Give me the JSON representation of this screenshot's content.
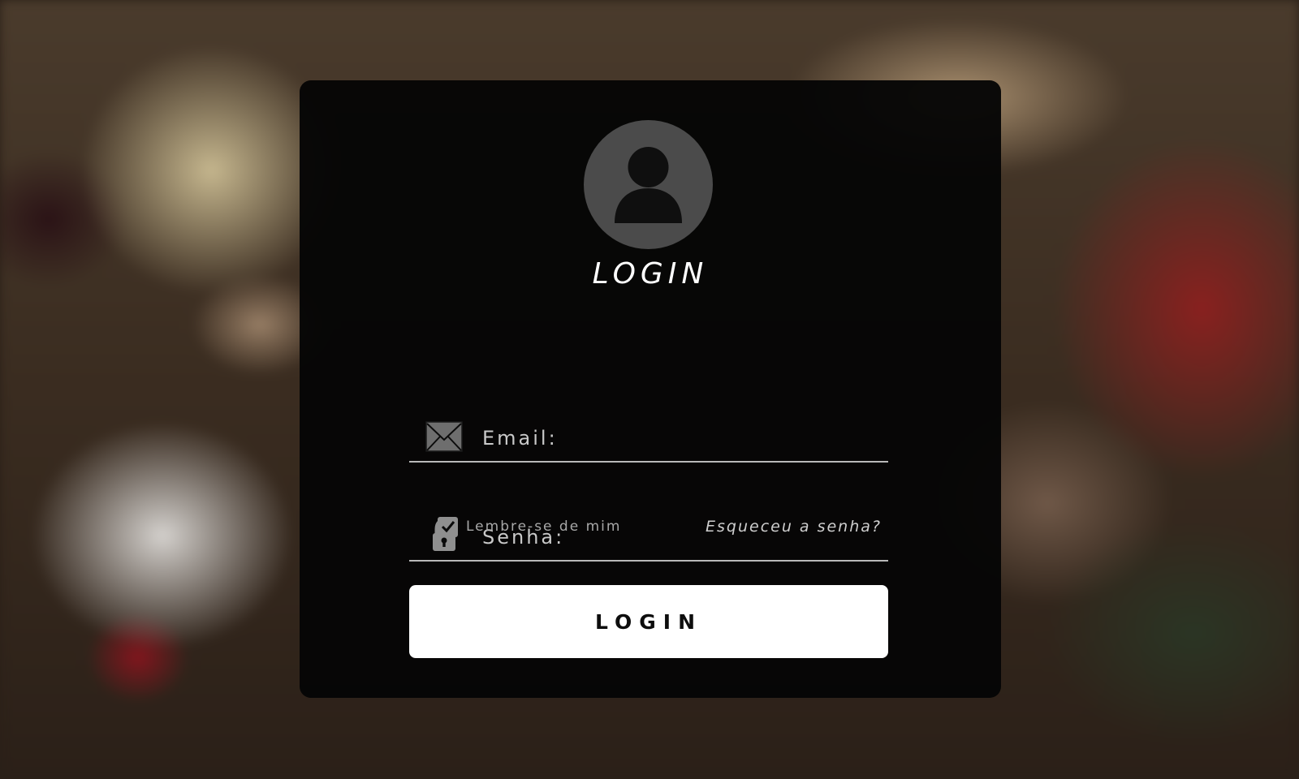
{
  "login_card": {
    "title": "LOGIN",
    "avatar_icon": "user-avatar-icon",
    "email": {
      "icon": "envelope-icon",
      "placeholder": "Email:",
      "value": ""
    },
    "password": {
      "icon": "lock-icon",
      "placeholder": "Senha:",
      "value": ""
    },
    "remember_me": {
      "label": "Lembre-se de mim",
      "checked": true
    },
    "forgot_password": "Esqueceu a senha?",
    "submit_label": "LOGIN"
  },
  "colors": {
    "card_background": "#050505",
    "avatar_circle": "#4b4b4b",
    "button_background": "#ffffff",
    "button_text": "#0d0d0d",
    "field_underline": "#b9b9b9"
  }
}
